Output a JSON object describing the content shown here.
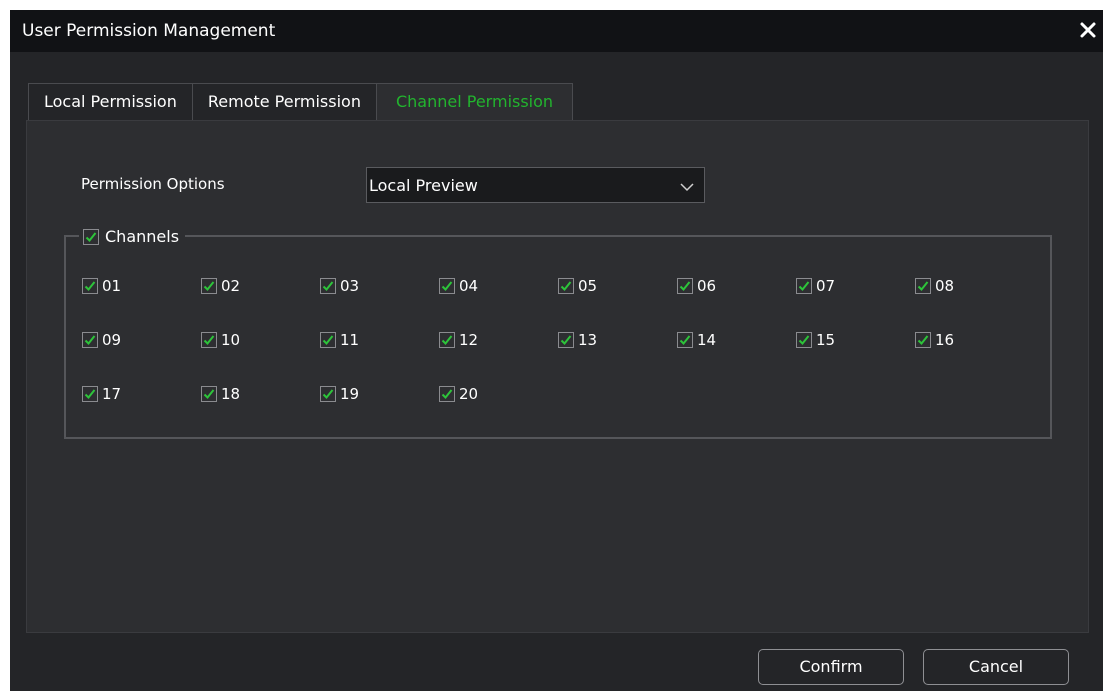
{
  "window": {
    "title": "User Permission Management",
    "close_icon": "close-icon"
  },
  "tabs": [
    {
      "label": "Local Permission",
      "active": false
    },
    {
      "label": "Remote Permission",
      "active": false
    },
    {
      "label": "Channel Permission",
      "active": true
    }
  ],
  "permission": {
    "label": "Permission Options",
    "selected": "Local Preview",
    "chevron_icon": "chevron-down-icon"
  },
  "channels": {
    "label": "Channels",
    "all_checked": true,
    "items": [
      {
        "label": "01",
        "checked": true
      },
      {
        "label": "02",
        "checked": true
      },
      {
        "label": "03",
        "checked": true
      },
      {
        "label": "04",
        "checked": true
      },
      {
        "label": "05",
        "checked": true
      },
      {
        "label": "06",
        "checked": true
      },
      {
        "label": "07",
        "checked": true
      },
      {
        "label": "08",
        "checked": true
      },
      {
        "label": "09",
        "checked": true
      },
      {
        "label": "10",
        "checked": true
      },
      {
        "label": "11",
        "checked": true
      },
      {
        "label": "12",
        "checked": true
      },
      {
        "label": "13",
        "checked": true
      },
      {
        "label": "14",
        "checked": true
      },
      {
        "label": "15",
        "checked": true
      },
      {
        "label": "16",
        "checked": true
      },
      {
        "label": "17",
        "checked": true
      },
      {
        "label": "18",
        "checked": true
      },
      {
        "label": "19",
        "checked": true
      },
      {
        "label": "20",
        "checked": true
      }
    ]
  },
  "buttons": {
    "confirm": "Confirm",
    "cancel": "Cancel"
  },
  "colors": {
    "accent": "#22b42e",
    "check": "#2dc43a",
    "background": "#242528",
    "titlebar": "#111215"
  }
}
